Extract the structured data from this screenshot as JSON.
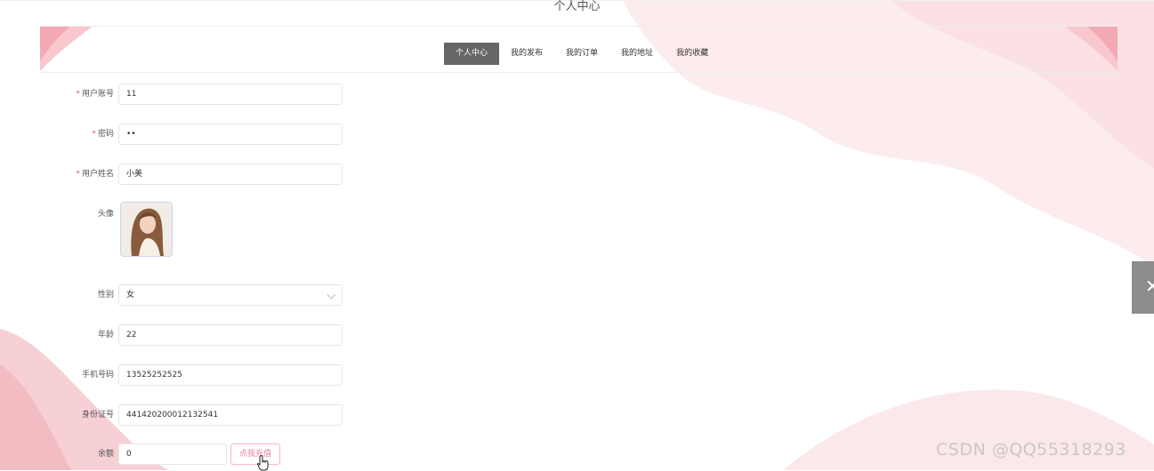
{
  "page": {
    "title": "个人中心"
  },
  "nav": {
    "tabs": [
      {
        "label": "个人中心",
        "active": true
      },
      {
        "label": "我的发布",
        "active": false
      },
      {
        "label": "我的订单",
        "active": false
      },
      {
        "label": "我的地址",
        "active": false
      },
      {
        "label": "我的收藏",
        "active": false
      }
    ]
  },
  "form": {
    "account": {
      "label": "用户账号",
      "required": true,
      "value": "11"
    },
    "password": {
      "label": "密码",
      "required": true,
      "value": "••"
    },
    "name": {
      "label": "用户姓名",
      "required": true,
      "value": "小美"
    },
    "avatar": {
      "label": "头像"
    },
    "gender": {
      "label": "性别",
      "value": "女"
    },
    "age": {
      "label": "年龄",
      "value": "22"
    },
    "phone": {
      "label": "手机号码",
      "value": "13525252525"
    },
    "idcard": {
      "label": "身份证号",
      "value": "441420200012132541"
    },
    "balance": {
      "label": "余额",
      "value": "0",
      "button": "点我充值"
    }
  },
  "watermark": "CSDN @QQ55318293",
  "colors": {
    "accent": "#e6809b",
    "tab_active": "#666666",
    "required": "#e65b5b"
  }
}
